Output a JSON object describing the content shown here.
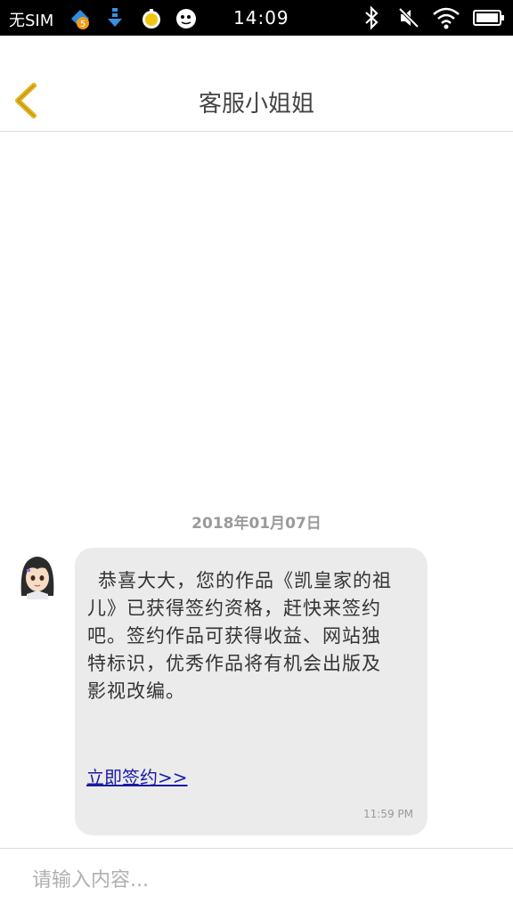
{
  "status_bar": {
    "carrier": "无SIM",
    "time": "14:09",
    "app_icons": [
      "cloud-badge-icon",
      "download-icon",
      "emoji-bulb-icon",
      "face-icon"
    ],
    "right_icons": [
      "bluetooth-icon",
      "mute-icon",
      "wifi-icon",
      "battery-icon"
    ]
  },
  "header": {
    "title": "客服小姐姐",
    "back_icon": "chevron-left-icon",
    "accent_color": "#e3b21f"
  },
  "chat": {
    "date": "2018年01月07日",
    "messages": [
      {
        "sender_avatar": "anime-girl-avatar",
        "text": "恭喜大大，您的作品《凯皇家的祖儿》已获得签约资格，赶快来签约吧。签约作品可获得收益、网站独特标识，优秀作品将有机会出版及影视改编。",
        "link_label": "立即签约>> ",
        "time": "11:59 PM"
      }
    ]
  },
  "input": {
    "placeholder": "请输入内容..."
  }
}
